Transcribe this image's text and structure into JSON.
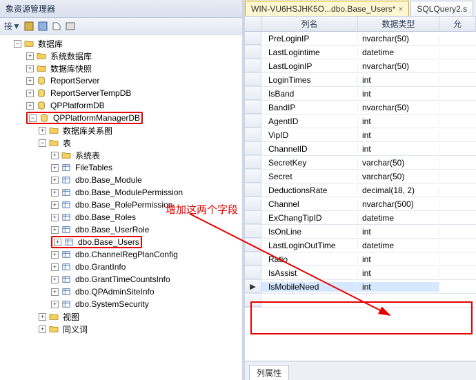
{
  "explorer": {
    "title": "象资源管理器",
    "connect_label": "接▼",
    "root_folder": "数据库",
    "system_folders": [
      "系统数据库",
      "数据库快照"
    ],
    "databases": [
      "ReportServer",
      "ReportServerTempDB",
      "QPPlatformDB"
    ],
    "selected_db": "QPPlatformManagerDB",
    "db_subfolders": {
      "diagrams": "数据库关系图",
      "tables": "表",
      "systables": "系统表"
    },
    "tables": [
      "FileTables",
      "dbo.Base_Module",
      "dbo.Base_ModulePermission",
      "dbo.Base_RolePermission",
      "dbo.Base_Roles",
      "dbo.Base_UserRole",
      "dbo.Base_Users",
      "dbo.ChannelRegPlanConfig",
      "dbo.GrantInfo",
      "dbo.GrantTimeCountsInfo",
      "dbo.QPAdminSiteInfo",
      "dbo.SystemSecurity"
    ],
    "post_folders": [
      "视图",
      "同义词"
    ]
  },
  "tabs": {
    "active": "WIN-VU6HSJHK5O...dbo.Base_Users*",
    "other": "SQLQuery2.s"
  },
  "grid": {
    "headers": {
      "colname": "列名",
      "datatype": "数据类型",
      "allownull": "允"
    },
    "rows": [
      {
        "name": "PreLoginIP",
        "type": "nvarchar(50)"
      },
      {
        "name": "LastLogintime",
        "type": "datetime"
      },
      {
        "name": "LastLoginIP",
        "type": "nvarchar(50)"
      },
      {
        "name": "LoginTimes",
        "type": "int"
      },
      {
        "name": "IsBand",
        "type": "int"
      },
      {
        "name": "BandIP",
        "type": "nvarchar(50)"
      },
      {
        "name": "AgentID",
        "type": "int"
      },
      {
        "name": "VipID",
        "type": "int"
      },
      {
        "name": "ChannelID",
        "type": "int"
      },
      {
        "name": "SecretKey",
        "type": "varchar(50)"
      },
      {
        "name": "Secret",
        "type": "varchar(50)"
      },
      {
        "name": "DeductionsRate",
        "type": "decimal(18, 2)"
      },
      {
        "name": "Channel",
        "type": "nvarchar(500)"
      },
      {
        "name": "ExChangTipID",
        "type": "datetime"
      },
      {
        "name": "IsOnLine",
        "type": "int"
      },
      {
        "name": "LastLoginOutTime",
        "type": "datetime"
      },
      {
        "name": "Ratio",
        "type": "int"
      },
      {
        "name": "IsAssist",
        "type": "int"
      },
      {
        "name": "IsMobileNeed",
        "type": "int",
        "selected": true
      }
    ],
    "props_tab": "列属性"
  },
  "annotation": {
    "text": "增加这两个字段"
  }
}
